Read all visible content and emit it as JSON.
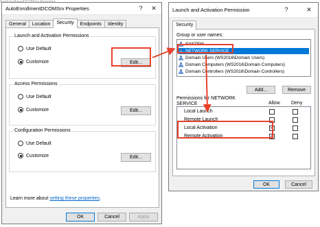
{
  "background_text": "AutoEnrollmentDCOMSrv Properties",
  "left_dialog": {
    "title": "AutoEnrollmentDCOMSrv Properties",
    "help_button": "?",
    "close_button": "✕",
    "tabs": [
      "General",
      "Location",
      "Security",
      "Endpoints",
      "Identity"
    ],
    "active_tab": "Security",
    "launch_group": {
      "label": "Launch and Activation Permissions",
      "use_default": "Use Default",
      "customize": "Customize",
      "edit": "Edit..."
    },
    "access_group": {
      "label": "Access Permissions",
      "use_default": "Use Default",
      "customize": "Customize",
      "edit": "Edit..."
    },
    "config_group": {
      "label": "Configuration Permissions",
      "use_default": "Use Default",
      "customize": "Customize",
      "edit": "Edit..."
    },
    "learn_more_prefix": "Learn more about ",
    "learn_more_link": "setting these properties",
    "learn_more_suffix": ".",
    "ok": "OK",
    "cancel": "Cancel",
    "apply": "Apply"
  },
  "right_dialog": {
    "title": "Launch and Activation Permission",
    "help_button": "?",
    "close_button": "✕",
    "tab": "Security",
    "group_label": "Group or user names:",
    "users": [
      {
        "name": "SYSTEM",
        "selected": false
      },
      {
        "name": "NETWORK SERVICE",
        "selected": true
      },
      {
        "name": "Domain Users (WS2016\\Domain Users)",
        "selected": false
      },
      {
        "name": "Domain Computers (WS2016\\Domain Computers)",
        "selected": false
      },
      {
        "name": "Domain Controllers (WS2016\\Domain Controllers)",
        "selected": false
      }
    ],
    "add": "Add...",
    "remove": "Remove",
    "perm_label_1": "Permissions for NETWORK",
    "perm_label_2": "SERVICE",
    "allow_header": "Allow",
    "deny_header": "Deny",
    "permissions": [
      {
        "name": "Local Launch",
        "allow": false,
        "deny": false
      },
      {
        "name": "Remote Launch",
        "allow": false,
        "deny": false
      },
      {
        "name": "Local Activation",
        "allow": true,
        "deny": false
      },
      {
        "name": "Remote Activation",
        "allow": true,
        "deny": false
      }
    ],
    "ok": "OK",
    "cancel": "Cancel"
  },
  "annotation_color": "#e8412b"
}
